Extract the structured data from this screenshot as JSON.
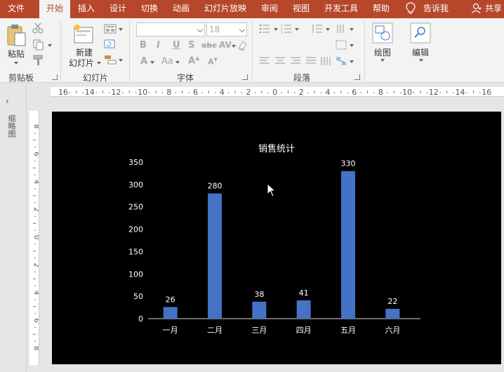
{
  "menu": {
    "tabs": [
      "文件",
      "开始",
      "插入",
      "设计",
      "切换",
      "动画",
      "幻灯片放映",
      "审阅",
      "视图",
      "开发工具",
      "帮助"
    ],
    "active": "开始",
    "tell_me": "告诉我",
    "share": "共享"
  },
  "ribbon": {
    "clipboard": {
      "paste_label": "粘贴",
      "group_label": "剪贴板"
    },
    "slides": {
      "new_slide_line1": "新建",
      "new_slide_line2": "幻灯片",
      "group_label": "幻灯片"
    },
    "font": {
      "font_size": "18",
      "group_label": "字体"
    },
    "paragraph": {
      "group_label": "段落"
    },
    "drawing": {
      "label": "绘图"
    },
    "editing": {
      "label": "编辑"
    }
  },
  "left_panel": {
    "toggle": "›",
    "label": "缩略图"
  },
  "ruler": {
    "h_labels": [
      "16",
      "14",
      "12",
      "10",
      "8",
      "6",
      "4",
      "2",
      "0",
      "2",
      "4",
      "6",
      "8",
      "10",
      "12",
      "14",
      "16"
    ],
    "v_labels": [
      "8",
      "6",
      "4",
      "2",
      "0",
      "2",
      "4",
      "6",
      "8"
    ]
  },
  "chart_data": {
    "type": "bar",
    "title": "销售统计",
    "categories": [
      "一月",
      "二月",
      "三月",
      "四月",
      "五月",
      "六月"
    ],
    "values": [
      26,
      280,
      38,
      41,
      330,
      22
    ],
    "ylim": [
      0,
      350
    ],
    "yticks": [
      0,
      50,
      100,
      150,
      200,
      250,
      300,
      350
    ],
    "bar_color": "#4472c4",
    "data_labels": true,
    "grid": false,
    "xlabel": "",
    "ylabel": ""
  },
  "colors": {
    "accent": "#b7472a",
    "ribbon_bg": "#f3f3f3",
    "slide_bg": "#000000",
    "text_white": "#ffffff"
  }
}
